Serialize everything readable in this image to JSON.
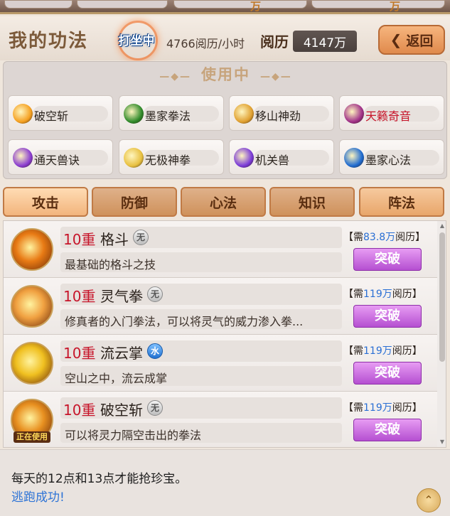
{
  "top_strip": {
    "partial_text_1": "万",
    "partial_text_2": "万"
  },
  "header": {
    "title": "我的功法",
    "meditate_label": "打坐中",
    "rate_text": "4766阅历/小时",
    "xp_label": "阅历",
    "xp_value": "4147万",
    "back_label": "返回"
  },
  "in_use": {
    "title": "使用中",
    "slots": [
      {
        "label": "破空斩",
        "icon": "slash-icon",
        "color": "#f5a020"
      },
      {
        "label": "墨家拳法",
        "icon": "fist-icon",
        "color": "#2f8a2a"
      },
      {
        "label": "移山神劲",
        "icon": "mountain-icon",
        "color": "#e0a030"
      },
      {
        "label": "天籁奇音",
        "icon": "music-icon",
        "color": "#a03088",
        "highlight": true
      },
      {
        "label": "通天兽诀",
        "icon": "beast-icon",
        "color": "#8a3cd0"
      },
      {
        "label": "无极神拳",
        "icon": "palm-icon",
        "color": "#e8c040"
      },
      {
        "label": "机关兽",
        "icon": "mech-beast-icon",
        "color": "#7a3ad8"
      },
      {
        "label": "墨家心法",
        "icon": "spirit-icon",
        "color": "#1e6ad0"
      }
    ]
  },
  "tabs": [
    {
      "label": "攻击"
    },
    {
      "label": "防御"
    },
    {
      "label": "心法"
    },
    {
      "label": "知识"
    },
    {
      "label": "阵法"
    }
  ],
  "skills": [
    {
      "level": "10重",
      "name": "格斗",
      "element": "无",
      "element_type": "none",
      "cost_prefix": "【需",
      "cost_value": "83.8万",
      "cost_suffix": "阅历】",
      "desc": "最基础的格斗之技",
      "button": "突破",
      "icon": "fist-fire-icon",
      "in_use": false
    },
    {
      "level": "10重",
      "name": "灵气拳",
      "element": "无",
      "element_type": "none",
      "cost_prefix": "【需",
      "cost_value": "119万",
      "cost_suffix": "阅历】",
      "desc": "修真者的入门拳法，可以将灵气的威力渗入拳...",
      "button": "突破",
      "icon": "spirit-fist-icon",
      "in_use": false
    },
    {
      "level": "10重",
      "name": "流云掌",
      "element": "水",
      "element_type": "water",
      "cost_prefix": "【需",
      "cost_value": "119万",
      "cost_suffix": "阅历】",
      "desc": "空山之中，流云成掌",
      "button": "突破",
      "icon": "cloud-palm-icon",
      "in_use": false
    },
    {
      "level": "10重",
      "name": "破空斩",
      "element": "无",
      "element_type": "none",
      "cost_prefix": "【需",
      "cost_value": "119万",
      "cost_suffix": "阅历】",
      "desc": "可以将灵力隔空击出的拳法",
      "button": "突破",
      "icon": "slash-icon",
      "in_use": true,
      "in_use_label": "正在使用"
    }
  ],
  "messages": {
    "line1": "每天的12点和13点才能抢珍宝。",
    "line2": "逃跑成功!"
  }
}
